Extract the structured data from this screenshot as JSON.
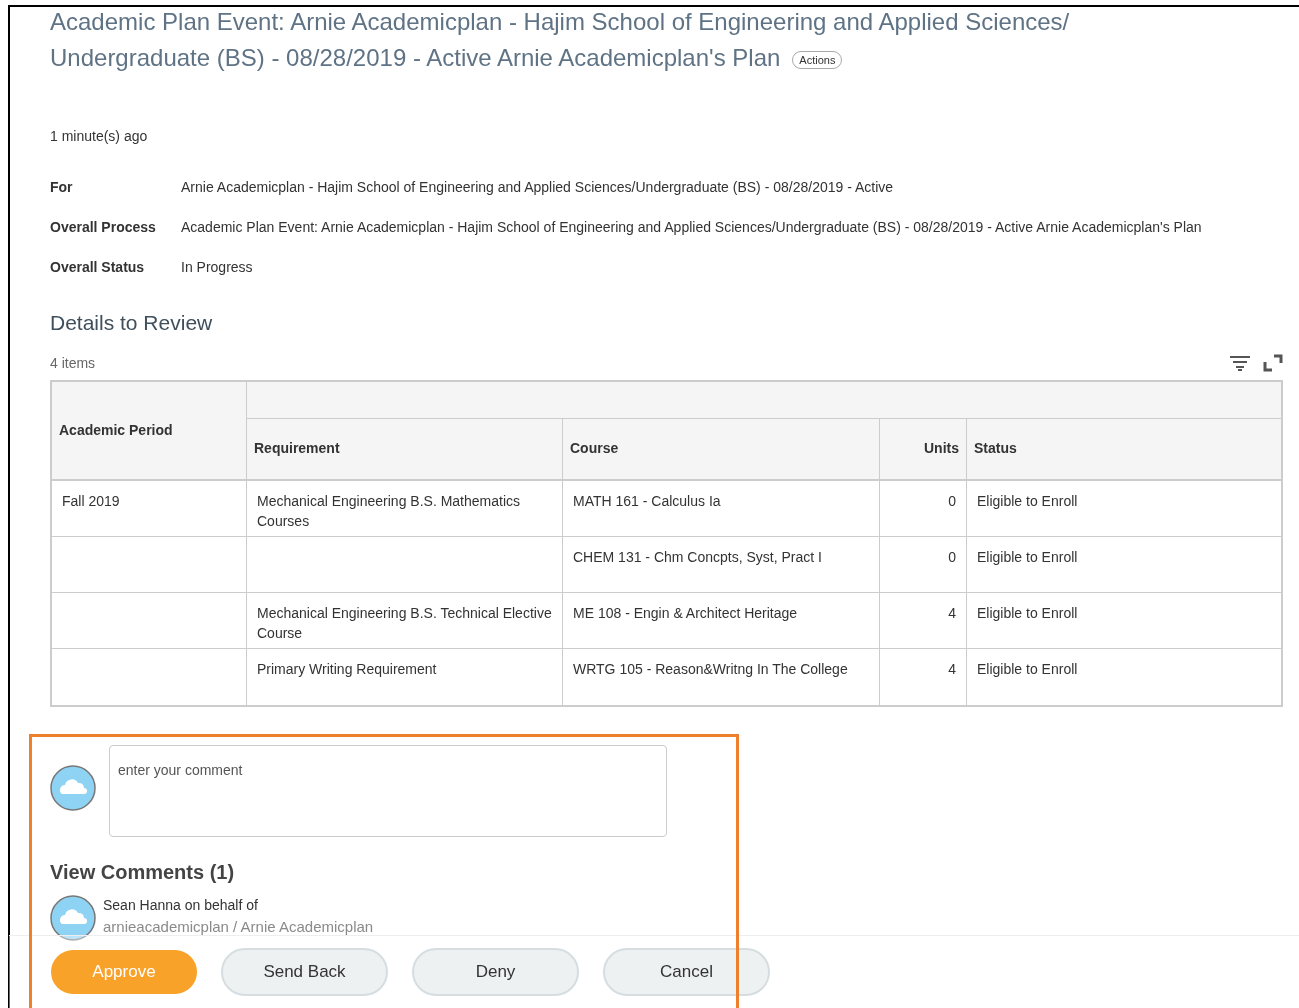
{
  "title": "Academic Plan Event: Arnie Academicplan - Hajim School of Engineering and Applied Sciences/ Undergraduate (BS) - 08/28/2019 - Active Arnie Academicplan's Plan",
  "actions_button": "Actions",
  "time": "1 minute(s) ago",
  "fields": [
    {
      "label": "For",
      "value": "Arnie Academicplan - Hajim School of Engineering and Applied Sciences/Undergraduate (BS) - 08/28/2019 - Active"
    },
    {
      "label": "Overall Process",
      "value": "Academic Plan Event: Arnie Academicplan - Hajim School of Engineering and Applied Sciences/Undergraduate (BS) - 08/28/2019 - Active Arnie Academicplan's Plan"
    },
    {
      "label": "Overall Status",
      "value": "In Progress"
    }
  ],
  "section_title": "Details to Review",
  "item_count": "4 items",
  "table": {
    "columns": [
      "Academic Period",
      "Requirement",
      "Course",
      "Units",
      "Status"
    ],
    "rows": [
      {
        "cells": [
          "Fall 2019",
          "Mechanical Engineering B.S. Mathematics Courses",
          "MATH 161 - Calculus Ia",
          "0",
          "Eligible to Enroll"
        ]
      },
      {
        "cells": [
          "",
          "",
          "CHEM 131 - Chm Concpts, Syst, Pract I",
          "0",
          "Eligible to Enroll"
        ]
      },
      {
        "cells": [
          "",
          "Mechanical Engineering B.S. Technical Elective Course",
          "ME 108 - Engin & Architect Heritage",
          "4",
          "Eligible to Enroll"
        ]
      },
      {
        "cells": [
          "",
          "Primary Writing Requirement",
          "WRTG 105 - Reason&Writng In The College",
          "4",
          "Eligible to Enroll"
        ]
      }
    ]
  },
  "comment_box": {
    "placeholder": "enter your comment"
  },
  "comments": {
    "title": "View Comments (1)",
    "items": [
      {
        "author": "Sean Hanna on behalf of",
        "subtitle": "arnieacademicplan / Arnie Academicplan"
      }
    ]
  },
  "buttons": [
    {
      "label": "Approve",
      "kind": "primary"
    },
    {
      "label": "Send Back",
      "kind": "secondary"
    },
    {
      "label": "Deny",
      "kind": "secondary"
    },
    {
      "label": "Cancel",
      "kind": "secondary"
    }
  ]
}
